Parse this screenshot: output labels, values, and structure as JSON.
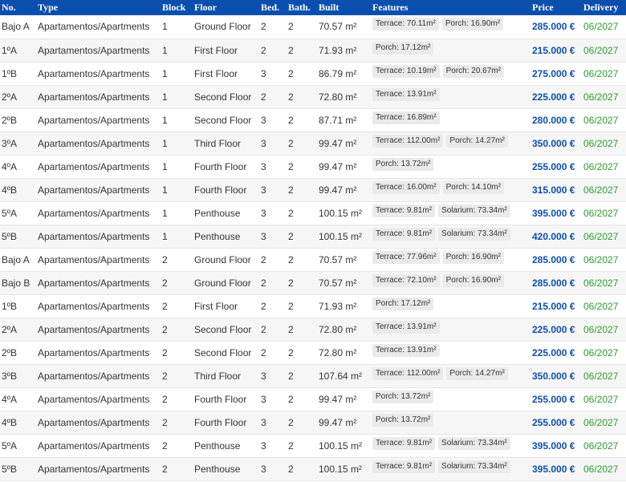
{
  "headers": {
    "no": "No.",
    "type": "Type",
    "block": "Block",
    "floor": "Floor",
    "bed": "Bed.",
    "bath": "Bath.",
    "built": "Built",
    "features": "Features",
    "price": "Price",
    "delivery": "Delivery"
  },
  "rows": [
    {
      "no": "Bajo A",
      "type": "Apartamentos/Apartments",
      "block": "1",
      "floor": "Ground Floor",
      "bed": "2",
      "bath": "2",
      "built": "70.57 m²",
      "features": [
        "Terrace: 70.11m²",
        "Porch: 16.90m²"
      ],
      "price": "285.000 €",
      "delivery": "06/2027"
    },
    {
      "no": "1ºA",
      "type": "Apartamentos/Apartments",
      "block": "1",
      "floor": "First Floor",
      "bed": "2",
      "bath": "2",
      "built": "71.93 m²",
      "features": [
        "Porch: 17.12m²"
      ],
      "price": "215.000 €",
      "delivery": "06/2027"
    },
    {
      "no": "1ºB",
      "type": "Apartamentos/Apartments",
      "block": "1",
      "floor": "First Floor",
      "bed": "3",
      "bath": "2",
      "built": "86.79 m²",
      "features": [
        "Terrace: 10.19m²",
        "Porch: 20.67m²"
      ],
      "price": "275.000 €",
      "delivery": "06/2027"
    },
    {
      "no": "2ºA",
      "type": "Apartamentos/Apartments",
      "block": "1",
      "floor": "Second Floor",
      "bed": "2",
      "bath": "2",
      "built": "72.80 m²",
      "features": [
        "Terrace: 13.91m²"
      ],
      "price": "225.000 €",
      "delivery": "06/2027"
    },
    {
      "no": "2ºB",
      "type": "Apartamentos/Apartments",
      "block": "1",
      "floor": "Second Floor",
      "bed": "3",
      "bath": "2",
      "built": "87.71 m²",
      "features": [
        "Terrace: 16.89m²"
      ],
      "price": "280.000 €",
      "delivery": "06/2027"
    },
    {
      "no": "3ºA",
      "type": "Apartamentos/Apartments",
      "block": "1",
      "floor": "Third Floor",
      "bed": "3",
      "bath": "2",
      "built": "99.47 m²",
      "features": [
        "Terrace: 112.00m²",
        "Porch: 14.27m²"
      ],
      "price": "350.000 €",
      "delivery": "06/2027"
    },
    {
      "no": "4ºA",
      "type": "Apartamentos/Apartments",
      "block": "1",
      "floor": "Fourth Floor",
      "bed": "3",
      "bath": "2",
      "built": "99.47 m²",
      "features": [
        "Porch: 13.72m²"
      ],
      "price": "255.000 €",
      "delivery": "06/2027"
    },
    {
      "no": "4ºB",
      "type": "Apartamentos/Apartments",
      "block": "1",
      "floor": "Fourth Floor",
      "bed": "3",
      "bath": "2",
      "built": "99.47 m²",
      "features": [
        "Terrace: 16.00m²",
        "Porch: 14.10m²"
      ],
      "price": "315.000 €",
      "delivery": "06/2027"
    },
    {
      "no": "5ºA",
      "type": "Apartamentos/Apartments",
      "block": "1",
      "floor": "Penthouse",
      "bed": "3",
      "bath": "2",
      "built": "100.15 m²",
      "features": [
        "Terrace: 9.81m²",
        "Solarium: 73.34m²"
      ],
      "price": "395.000 €",
      "delivery": "06/2027"
    },
    {
      "no": "5ºB",
      "type": "Apartamentos/Apartments",
      "block": "1",
      "floor": "Penthouse",
      "bed": "3",
      "bath": "2",
      "built": "100.15 m²",
      "features": [
        "Terrace: 9.81m²",
        "Solarium: 73.34m²"
      ],
      "price": "420.000 €",
      "delivery": "06/2027"
    },
    {
      "no": "Bajo A",
      "type": "Apartamentos/Apartments",
      "block": "2",
      "floor": "Ground Floor",
      "bed": "2",
      "bath": "2",
      "built": "70.57 m²",
      "features": [
        "Terrace: 77.96m²",
        "Porch: 16.90m²"
      ],
      "price": "285.000 €",
      "delivery": "06/2027"
    },
    {
      "no": "Bajo B",
      "type": "Apartamentos/Apartments",
      "block": "2",
      "floor": "Ground Floor",
      "bed": "2",
      "bath": "2",
      "built": "70.57 m²",
      "features": [
        "Terrace: 72.10m²",
        "Porch: 16.90m²"
      ],
      "price": "285.000 €",
      "delivery": "06/2027"
    },
    {
      "no": "1ºB",
      "type": "Apartamentos/Apartments",
      "block": "2",
      "floor": "First Floor",
      "bed": "2",
      "bath": "2",
      "built": "71.93 m²",
      "features": [
        "Porch: 17.12m²"
      ],
      "price": "215.000 €",
      "delivery": "06/2027"
    },
    {
      "no": "2ºA",
      "type": "Apartamentos/Apartments",
      "block": "2",
      "floor": "Second Floor",
      "bed": "2",
      "bath": "2",
      "built": "72.80 m²",
      "features": [
        "Terrace: 13.91m²"
      ],
      "price": "225.000 €",
      "delivery": "06/2027"
    },
    {
      "no": "2ºB",
      "type": "Apartamentos/Apartments",
      "block": "2",
      "floor": "Second Floor",
      "bed": "2",
      "bath": "2",
      "built": "72.80 m²",
      "features": [
        "Terrace: 13.91m²"
      ],
      "price": "225.000 €",
      "delivery": "06/2027"
    },
    {
      "no": "3ºB",
      "type": "Apartamentos/Apartments",
      "block": "2",
      "floor": "Third Floor",
      "bed": "3",
      "bath": "2",
      "built": "107.64 m²",
      "features": [
        "Terrace: 112.00m²",
        "Porch: 14.27m²"
      ],
      "price": "350.000 €",
      "delivery": "06/2027"
    },
    {
      "no": "4ºA",
      "type": "Apartamentos/Apartments",
      "block": "2",
      "floor": "Fourth Floor",
      "bed": "3",
      "bath": "2",
      "built": "99.47 m²",
      "features": [
        "Porch: 13.72m²"
      ],
      "price": "255.000 €",
      "delivery": "06/2027"
    },
    {
      "no": "4ºB",
      "type": "Apartamentos/Apartments",
      "block": "2",
      "floor": "Fourth Floor",
      "bed": "3",
      "bath": "2",
      "built": "99.47 m²",
      "features": [
        "Porch: 13.72m²"
      ],
      "price": "255.000 €",
      "delivery": "06/2027"
    },
    {
      "no": "5ºA",
      "type": "Apartamentos/Apartments",
      "block": "2",
      "floor": "Penthouse",
      "bed": "3",
      "bath": "2",
      "built": "100.15 m²",
      "features": [
        "Terrace: 9.81m²",
        "Solarium: 73.34m²"
      ],
      "price": "395.000 €",
      "delivery": "06/2027"
    },
    {
      "no": "5ºB",
      "type": "Apartamentos/Apartments",
      "block": "2",
      "floor": "Penthouse",
      "bed": "3",
      "bath": "2",
      "built": "100.15 m²",
      "features": [
        "Terrace: 9.81m²",
        "Solarium: 73.34m²"
      ],
      "price": "395.000 €",
      "delivery": "06/2027"
    }
  ],
  "colors": {
    "header_bg": "#0b4fae",
    "price": "#0b4fae",
    "delivery": "#2e9d2e",
    "row_alt": "#f6f6f6"
  }
}
